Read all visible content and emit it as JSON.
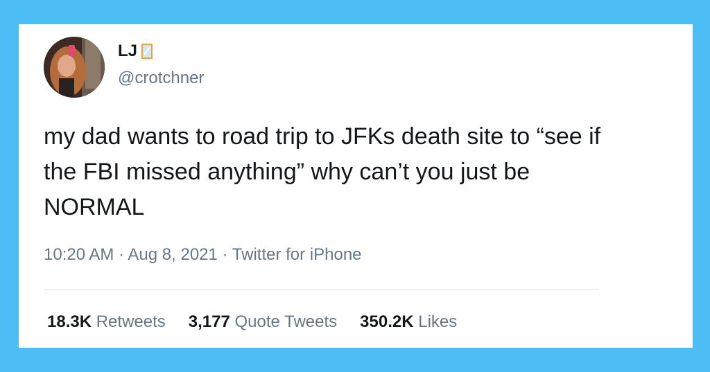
{
  "colors": {
    "background": "#4dbdf5",
    "card": "#ffffff",
    "text_primary": "#14171a",
    "text_secondary": "#657786"
  },
  "tweet": {
    "author": {
      "display_name": "LJ",
      "name_emoji_icon": "mirror-icon",
      "handle": "@crotchner",
      "avatar_icon": "avatar-photo"
    },
    "text": "my dad wants to road trip to JFKs death site to “see if the FBI missed anything” why can’t you just be NORMAL",
    "meta": {
      "time": "10:20 AM",
      "separator": "·",
      "date": "Aug 8, 2021",
      "source": "Twitter for iPhone"
    },
    "stats": {
      "retweets_count": "18.3K",
      "retweets_label": "Retweets",
      "quote_tweets_count": "3,177",
      "quote_tweets_label": "Quote Tweets",
      "likes_count": "350.2K",
      "likes_label": "Likes"
    }
  }
}
